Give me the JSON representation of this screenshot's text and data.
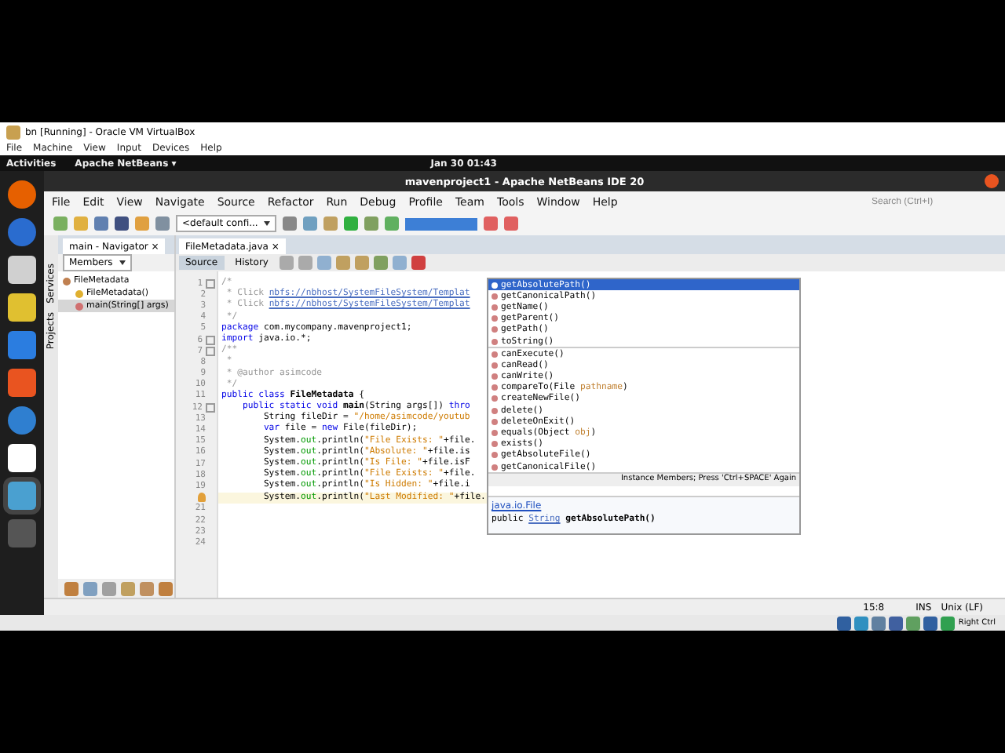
{
  "vm_window": {
    "title": "bn [Running] - Oracle VM VirtualBox",
    "menu": [
      "File",
      "Machine",
      "View",
      "Input",
      "Devices",
      "Help"
    ]
  },
  "top_bar": {
    "activities": "Activities",
    "app": "Apache NetBeans ▾",
    "clock": "Jan 30  01:43"
  },
  "dock": [
    {
      "kind": "firefox",
      "selected": false
    },
    {
      "kind": "mail",
      "selected": false
    },
    {
      "kind": "files",
      "selected": false
    },
    {
      "kind": "music",
      "selected": false
    },
    {
      "kind": "writer",
      "selected": false
    },
    {
      "kind": "store",
      "selected": false
    },
    {
      "kind": "help",
      "selected": false
    },
    {
      "kind": "amazon",
      "selected": false
    },
    {
      "kind": "netbeans",
      "selected": true
    },
    {
      "kind": "grid",
      "selected": false
    }
  ],
  "ide": {
    "title": "mavenproject1 - Apache NetBeans IDE 20",
    "menu": [
      "File",
      "Edit",
      "View",
      "Navigate",
      "Source",
      "Refactor",
      "Run",
      "Debug",
      "Profile",
      "Team",
      "Tools",
      "Window",
      "Help"
    ],
    "config": "<default confi...",
    "search": {
      "placeholder": "Search (Ctrl+I)"
    },
    "side_tabs": [
      "Services",
      "Projects"
    ],
    "navigator": {
      "tab": "main - Navigator",
      "close": "×",
      "filter": "Members",
      "tree": [
        {
          "label": "FileMetadata",
          "kind": "class",
          "selected": false,
          "children": [
            {
              "label": "FileMetadata()",
              "kind": "constructor",
              "selected": false
            },
            {
              "label": "main(String[] args)",
              "kind": "method",
              "selected": true
            }
          ]
        }
      ]
    },
    "editor": {
      "tab": "FileMetadata.java",
      "close": "×",
      "views": [
        {
          "label": "Source",
          "selected": true
        },
        {
          "label": "History",
          "selected": false
        }
      ],
      "lines": [
        {
          "number": "1",
          "fold": true,
          "current": false,
          "tokens": [
            {
              "text": "/*",
              "kind": "comment"
            }
          ]
        },
        {
          "number": "2",
          "fold": false,
          "current": false,
          "tokens": [
            {
              "text": " * Click ",
              "kind": "comment"
            },
            {
              "text": "nbfs://nbhost/SystemFileSystem/Templat",
              "kind": "link"
            }
          ]
        },
        {
          "number": "3",
          "fold": false,
          "current": false,
          "tokens": [
            {
              "text": " * Click ",
              "kind": "comment"
            },
            {
              "text": "nbfs://nbhost/SystemFileSystem/Templat",
              "kind": "link"
            }
          ]
        },
        {
          "number": "4",
          "fold": false,
          "current": false,
          "tokens": [
            {
              "text": " */",
              "kind": "comment"
            }
          ]
        },
        {
          "number": "5",
          "fold": false,
          "current": false,
          "tokens": [
            {
              "text": "package",
              "kind": "keyword"
            },
            {
              "text": " com.mycompany.mavenproject1;",
              "kind": "plain"
            }
          ]
        },
        {
          "number": "6",
          "fold": true,
          "current": false,
          "tokens": [
            {
              "text": "import",
              "kind": "keyword"
            },
            {
              "text": " java.io.*;",
              "kind": "plain"
            }
          ]
        },
        {
          "number": "7",
          "fold": true,
          "current": false,
          "tokens": [
            {
              "text": "/**",
              "kind": "comment"
            }
          ]
        },
        {
          "number": "8",
          "fold": false,
          "current": false,
          "tokens": [
            {
              "text": " *",
              "kind": "comment"
            }
          ]
        },
        {
          "number": "9",
          "fold": false,
          "current": false,
          "tokens": [
            {
              "text": " * @author asimcode",
              "kind": "comment"
            }
          ]
        },
        {
          "number": "10",
          "fold": false,
          "current": false,
          "tokens": [
            {
              "text": " */",
              "kind": "comment"
            }
          ]
        },
        {
          "number": "11",
          "fold": false,
          "current": false,
          "tokens": [
            {
              "text": "public class ",
              "kind": "keyword"
            },
            {
              "text": "FileMetadata",
              "kind": "bold"
            },
            {
              "text": " {",
              "kind": "plain"
            }
          ]
        },
        {
          "number": "12",
          "fold": true,
          "current": false,
          "tokens": [
            {
              "text": "    public static void ",
              "kind": "keyword"
            },
            {
              "text": "main",
              "kind": "bold"
            },
            {
              "text": "(String args[]) ",
              "kind": "plain"
            },
            {
              "text": "thro",
              "kind": "keyword"
            }
          ]
        },
        {
          "number": "13",
          "fold": false,
          "current": false,
          "tokens": [
            {
              "text": "        String fileDir = ",
              "kind": "plain"
            },
            {
              "text": "\"/home/asimcode/youtub",
              "kind": "string"
            }
          ]
        },
        {
          "number": "14",
          "fold": false,
          "current": false,
          "tokens": [
            {
              "text": "        var",
              "kind": "keyword"
            },
            {
              "text": " file = ",
              "kind": "plain"
            },
            {
              "text": "new",
              "kind": "keyword"
            },
            {
              "text": " File(fileDir);",
              "kind": "plain"
            }
          ]
        },
        {
          "number": "15",
          "fold": false,
          "current": false,
          "tokens": [
            {
              "text": "        System.",
              "kind": "plain"
            },
            {
              "text": "out",
              "kind": "field"
            },
            {
              "text": ".println(",
              "kind": "plain"
            },
            {
              "text": "\"File Exists: \"",
              "kind": "string"
            },
            {
              "text": "+file.",
              "kind": "plain"
            }
          ]
        },
        {
          "number": "16",
          "fold": false,
          "current": false,
          "tokens": [
            {
              "text": "        System.",
              "kind": "plain"
            },
            {
              "text": "out",
              "kind": "field"
            },
            {
              "text": ".println(",
              "kind": "plain"
            },
            {
              "text": "\"Absolute: \"",
              "kind": "string"
            },
            {
              "text": "+file.is",
              "kind": "plain"
            }
          ]
        },
        {
          "number": "17",
          "fold": false,
          "current": false,
          "tokens": [
            {
              "text": "        System.",
              "kind": "plain"
            },
            {
              "text": "out",
              "kind": "field"
            },
            {
              "text": ".println(",
              "kind": "plain"
            },
            {
              "text": "\"Is File: \"",
              "kind": "string"
            },
            {
              "text": "+file.isF",
              "kind": "plain"
            }
          ]
        },
        {
          "number": "18",
          "fold": false,
          "current": false,
          "tokens": [
            {
              "text": "        System.",
              "kind": "plain"
            },
            {
              "text": "out",
              "kind": "field"
            },
            {
              "text": ".println(",
              "kind": "plain"
            },
            {
              "text": "\"File Exists: \"",
              "kind": "string"
            },
            {
              "text": "+file.",
              "kind": "plain"
            }
          ]
        },
        {
          "number": "19",
          "fold": false,
          "current": false,
          "tokens": [
            {
              "text": "        System.",
              "kind": "plain"
            },
            {
              "text": "out",
              "kind": "field"
            },
            {
              "text": ".println(",
              "kind": "plain"
            },
            {
              "text": "\"Is Hidden: \"",
              "kind": "string"
            },
            {
              "text": "+file.i",
              "kind": "plain"
            }
          ]
        },
        {
          "hint": true,
          "fold": false,
          "current": true,
          "tokens": [
            {
              "text": "        System.",
              "kind": "plain"
            },
            {
              "text": "out",
              "kind": "field"
            },
            {
              "text": ".println(",
              "kind": "plain"
            },
            {
              "text": "\"Last Modified: \"",
              "kind": "string"
            },
            {
              "text": "+file.",
              "kind": "plain"
            }
          ]
        },
        {
          "number": "21",
          "fold": false,
          "current": false
        },
        {
          "number": "22",
          "fold": false,
          "current": false
        },
        {
          "number": "23",
          "fold": false,
          "current": false
        },
        {
          "number": "24",
          "fold": false,
          "current": false
        }
      ],
      "completion": {
        "items": [
          {
            "selected": true,
            "divider_after": false,
            "tokens": [
              {
                "text": "getAbsolutePath()",
                "kind": "plain"
              }
            ]
          },
          {
            "selected": false,
            "divider_after": false,
            "tokens": [
              {
                "text": "getCanonicalPath()",
                "kind": "plain"
              }
            ]
          },
          {
            "selected": false,
            "divider_after": false,
            "tokens": [
              {
                "text": "getName()",
                "kind": "plain"
              }
            ]
          },
          {
            "selected": false,
            "divider_after": false,
            "tokens": [
              {
                "text": "getParent()",
                "kind": "plain"
              }
            ]
          },
          {
            "selected": false,
            "divider_after": false,
            "tokens": [
              {
                "text": "getPath()",
                "kind": "plain"
              }
            ]
          },
          {
            "selected": false,
            "divider_after": true,
            "tokens": [
              {
                "text": "toString()",
                "kind": "plain"
              }
            ]
          },
          {
            "selected": false,
            "divider_after": false,
            "tokens": [
              {
                "text": "canExecute()",
                "kind": "plain"
              }
            ]
          },
          {
            "selected": false,
            "divider_after": false,
            "tokens": [
              {
                "text": "canRead()",
                "kind": "plain"
              }
            ]
          },
          {
            "selected": false,
            "divider_after": false,
            "tokens": [
              {
                "text": "canWrite()",
                "kind": "plain"
              }
            ]
          },
          {
            "selected": false,
            "divider_after": false,
            "tokens": [
              {
                "text": "compareTo(File ",
                "kind": "plain"
              },
              {
                "text": "pathname",
                "kind": "param"
              },
              {
                "text": ")",
                "kind": "plain"
              }
            ]
          },
          {
            "selected": false,
            "divider_after": false,
            "tokens": [
              {
                "text": "createNewFile()",
                "kind": "plain"
              }
            ]
          },
          {
            "selected": false,
            "divider_after": false,
            "tokens": [
              {
                "text": "delete()",
                "kind": "plain"
              }
            ]
          },
          {
            "selected": false,
            "divider_after": false,
            "tokens": [
              {
                "text": "deleteOnExit()",
                "kind": "plain"
              }
            ]
          },
          {
            "selected": false,
            "divider_after": false,
            "tokens": [
              {
                "text": "equals(Object ",
                "kind": "plain"
              },
              {
                "text": "obj",
                "kind": "param"
              },
              {
                "text": ")",
                "kind": "plain"
              }
            ]
          },
          {
            "selected": false,
            "divider_after": false,
            "tokens": [
              {
                "text": "exists()",
                "kind": "plain"
              }
            ]
          },
          {
            "selected": false,
            "divider_after": false,
            "tokens": [
              {
                "text": "getAbsoluteFile()",
                "kind": "plain"
              }
            ]
          },
          {
            "selected": false,
            "divider_after": false,
            "tokens": [
              {
                "text": "getCanonicalFile()",
                "kind": "plain"
              }
            ]
          }
        ],
        "hint": "Instance Members; Press 'Ctrl+SPACE' Again",
        "doc": {
          "link": "java.io.File",
          "signature": [
            {
              "text": "public ",
              "kind": "plain"
            },
            {
              "text": "String",
              "kind": "link"
            },
            {
              "text": " getAbsolutePath()",
              "kind": "bold"
            }
          ]
        }
      }
    },
    "status": {
      "position": "15:8",
      "mode": "INS",
      "line_ending": "Unix (LF)"
    }
  },
  "vm_status": {
    "host_key": "Right Ctrl"
  }
}
